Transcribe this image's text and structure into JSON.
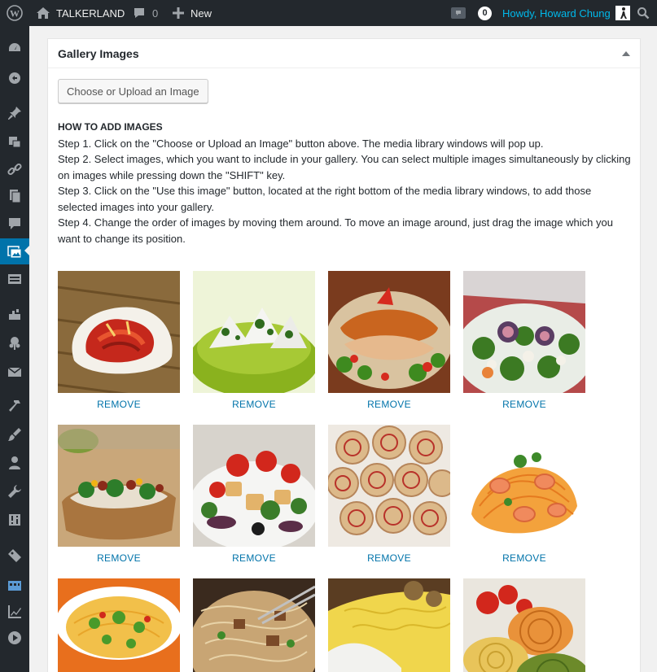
{
  "adminbar": {
    "wp_logo_icon": "wordpress-icon",
    "site_icon": "home-icon",
    "site_name": "TALKERLAND",
    "comments_icon": "comment-bubble-icon",
    "comments_count": "0",
    "new_icon": "plus-icon",
    "new_label": "New",
    "notification_icon": "notification-icon",
    "notification_count": "0",
    "howdy": "Howdy, Howard Chung",
    "search_icon": "search-icon"
  },
  "sidemenu": {
    "items": [
      "dashboard-icon",
      "refresh-icon",
      "pin-icon",
      "media-icon",
      "link-icon",
      "pages-icon",
      "comments-icon",
      "gallery-icon",
      "forms-icon",
      "appearance-icon",
      "plugins-icon",
      "mail-icon",
      "tools-hammer-icon",
      "brush-icon",
      "users-icon",
      "wrench-icon",
      "settings-icon",
      "tag-icon",
      "building-icon",
      "chart-icon",
      "play-icon"
    ],
    "active": "gallery-icon"
  },
  "postbox": {
    "title": "Gallery Images",
    "upload_button": "Choose or Upload an Image",
    "instructions": {
      "heading": "HOW TO ADD IMAGES",
      "step1": "Step 1. Click on the \"Choose or Upload an Image\" button above. The media library windows will pop up.",
      "step2": "Step 2. Select images, which you want to include in your gallery. You can select multiple images simultaneously by clicking on images while pressing down the \"SHIFT\" key.",
      "step3": "Step 3. Click on the \"Use this image\" button, located at the right bottom of the media library windows, to add those selected images into your gallery.",
      "step4": "Step 4. Change the order of images by moving them around. To move an image around, just drag the image which you want to change its position."
    }
  },
  "gallery": {
    "remove_label": "REMOVE",
    "colors": {
      "link": "#0073aa",
      "accent": "#0073aa"
    }
  }
}
